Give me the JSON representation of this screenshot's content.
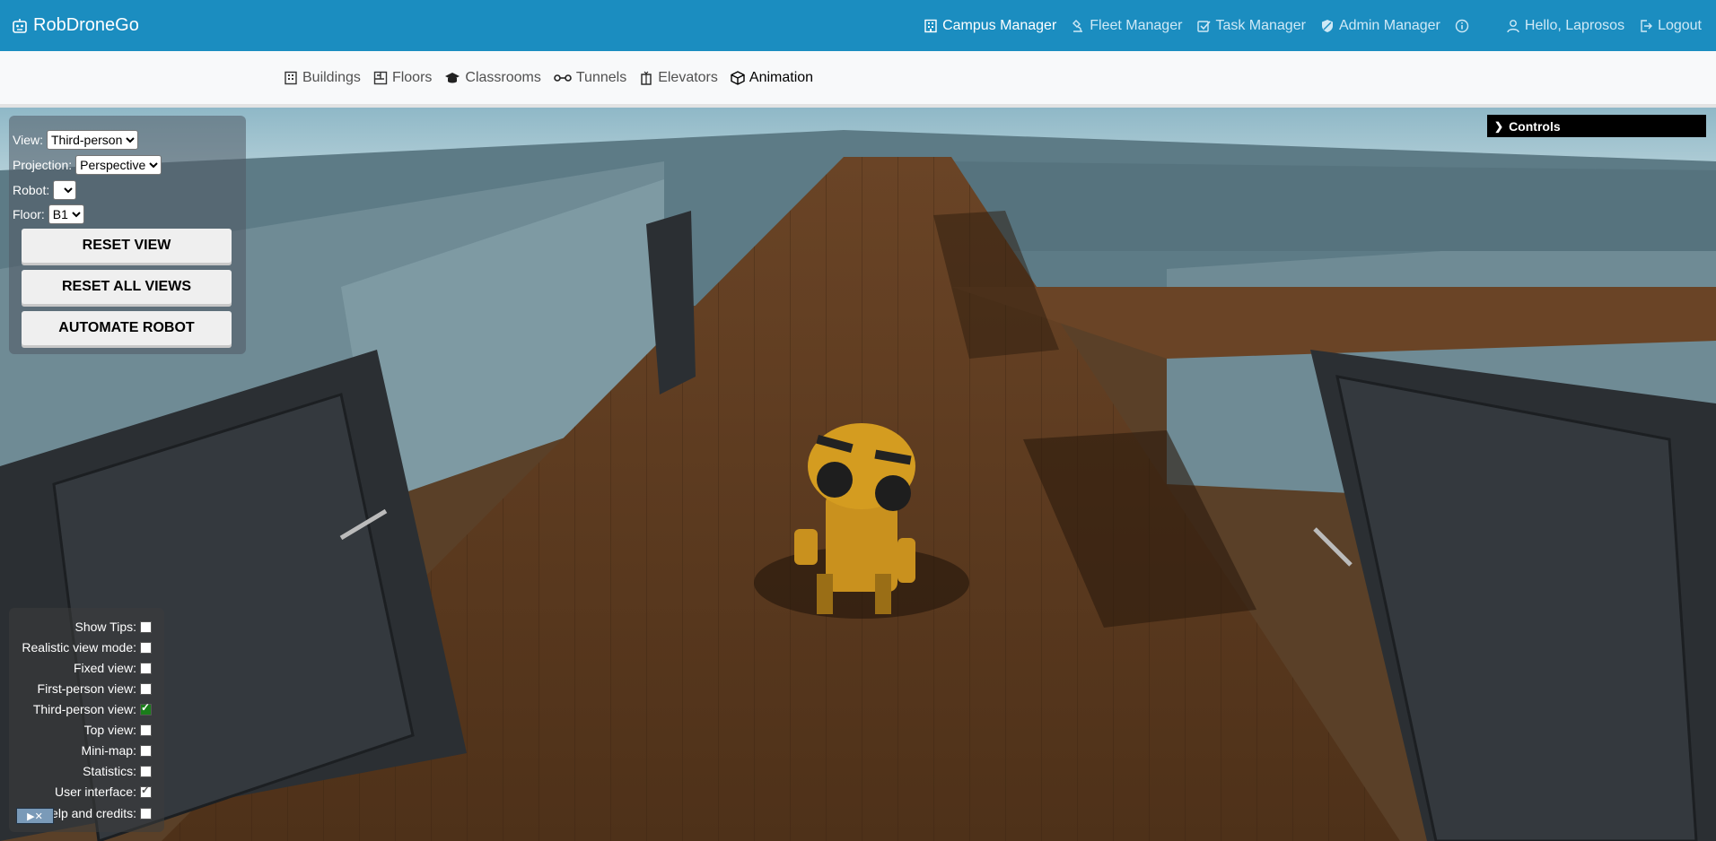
{
  "brand": {
    "name": "RobDroneGo",
    "icon": "robot-icon"
  },
  "topnav": {
    "items": [
      {
        "label": "Campus Manager",
        "icon": "building-icon"
      },
      {
        "label": "Fleet Manager",
        "icon": "microscope-icon"
      },
      {
        "label": "Task Manager",
        "icon": "check-square-icon"
      },
      {
        "label": "Admin Manager",
        "icon": "shield-icon"
      }
    ],
    "greeting": "Hello, Laprosos",
    "logout": "Logout"
  },
  "subnav": {
    "items": [
      {
        "label": "Buildings"
      },
      {
        "label": "Floors"
      },
      {
        "label": "Classrooms"
      },
      {
        "label": "Tunnels"
      },
      {
        "label": "Elevators"
      },
      {
        "label": "Animation"
      }
    ]
  },
  "panel": {
    "view_label": "View:",
    "view_value": "Third-person",
    "projection_label": "Projection:",
    "projection_value": "Perspective",
    "robot_label": "Robot:",
    "robot_value": "",
    "floor_label": "Floor:",
    "floor_value": "B1",
    "reset_view": "RESET VIEW",
    "reset_all": "RESET ALL VIEWS",
    "automate": "AUTOMATE ROBOT"
  },
  "controls": {
    "label": "Controls"
  },
  "options": [
    {
      "label": "Show Tips:",
      "checked": false
    },
    {
      "label": "Realistic view mode:",
      "checked": false
    },
    {
      "label": "Fixed view:",
      "checked": false
    },
    {
      "label": "First-person view:",
      "checked": false
    },
    {
      "label": "Third-person view:",
      "checked": true
    },
    {
      "label": "Top view:",
      "checked": false
    },
    {
      "label": "Mini-map:",
      "checked": false
    },
    {
      "label": "Statistics:",
      "checked": false
    },
    {
      "label": "User interface:",
      "checked": true
    },
    {
      "label": "elp and credits:",
      "checked": false
    }
  ]
}
